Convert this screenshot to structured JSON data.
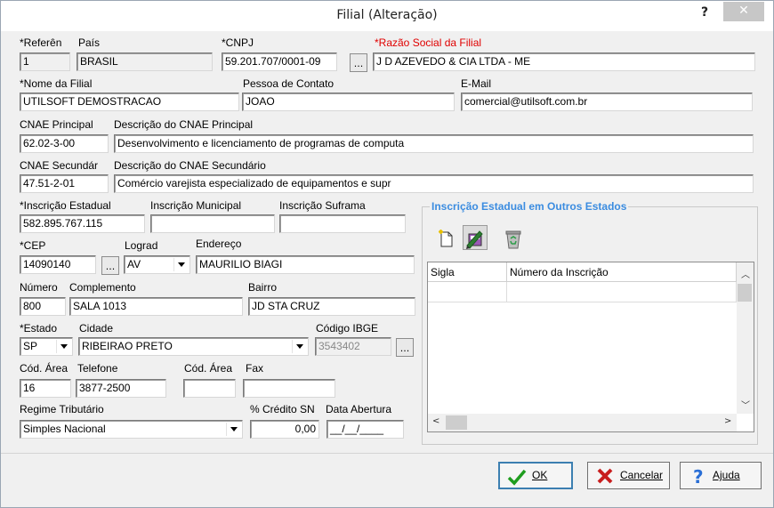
{
  "window": {
    "title": "Filial (Alteração)",
    "help": "?",
    "close": "✕"
  },
  "labels": {
    "referencia": "*Referên",
    "pais": "País",
    "cnpj": "*CNPJ",
    "razao_social": "*Razão Social da Filial",
    "nome_filial": "*Nome da Filial",
    "pessoa_contato": "Pessoa de Contato",
    "email": "E-Mail",
    "cnae_principal": "CNAE Principal",
    "desc_cnae_principal": "Descrição do CNAE Principal",
    "cnae_secundario": "CNAE Secundár",
    "desc_cnae_secundario": "Descrição do CNAE Secundário",
    "insc_estadual": "*Inscrição Estadual",
    "insc_municipal": "Inscrição Municipal",
    "insc_suframa": "Inscrição Suframa",
    "cep": "*CEP",
    "lograd": "Lograd",
    "endereco": "Endereço",
    "numero": "Número",
    "complemento": "Complemento",
    "bairro": "Bairro",
    "estado": "*Estado",
    "cidade": "Cidade",
    "codigo_ibge": "Código IBGE",
    "cod_area": "Cód. Área",
    "telefone": "Telefone",
    "cod_area2": "Cód. Área",
    "fax": "Fax",
    "regime": "Regime Tributário",
    "credito_sn": "% Crédito SN",
    "data_abertura": "Data Abertura"
  },
  "values": {
    "referencia": "1",
    "pais": "BRASIL",
    "cnpj": "59.201.707/0001-09",
    "razao_social": "J D AZEVEDO & CIA LTDA - ME",
    "nome_filial": "UTILSOFT DEMOSTRACAO",
    "pessoa_contato": "JOAO",
    "email": "comercial@utilsoft.com.br",
    "cnae_principal": "62.02-3-00",
    "desc_cnae_principal": "Desenvolvimento e licenciamento de programas de computa",
    "cnae_secundario": "47.51-2-01",
    "desc_cnae_secundario": "Comércio varejista especializado de equipamentos e supr",
    "insc_estadual": "582.895.767.115",
    "insc_municipal": "",
    "insc_suframa": "",
    "cep": "14090140",
    "lograd": "AV",
    "endereco": "MAURILIO BIAGI",
    "numero": "800",
    "complemento": "SALA 1013",
    "bairro": "JD STA CRUZ",
    "estado": "SP",
    "cidade": "RIBEIRAO PRETO",
    "codigo_ibge": "3543402",
    "cod_area": "16",
    "telefone": "3877-2500",
    "cod_area2": "",
    "fax": "",
    "regime": "Simples Nacional",
    "credito_sn": "0,00",
    "data_abertura": "__/__/____"
  },
  "ellipsis": "...",
  "ie_outros": {
    "title": "Inscrição Estadual em Outros Estados",
    "toolbar": [
      "new-document-icon",
      "edit-icon",
      "recycle-bin-icon"
    ],
    "columns": [
      "Sigla",
      "Número da Inscrição"
    ]
  },
  "buttons": {
    "ok": "OK",
    "cancelar": "Cancelar",
    "ajuda": "Ajuda"
  },
  "colors": {
    "required_red": "#e00000",
    "group_title_blue": "#3b8ce0",
    "ok_green": "#1f9d1f",
    "cancel_red": "#c81e1e",
    "help_blue": "#2a6fd6"
  }
}
